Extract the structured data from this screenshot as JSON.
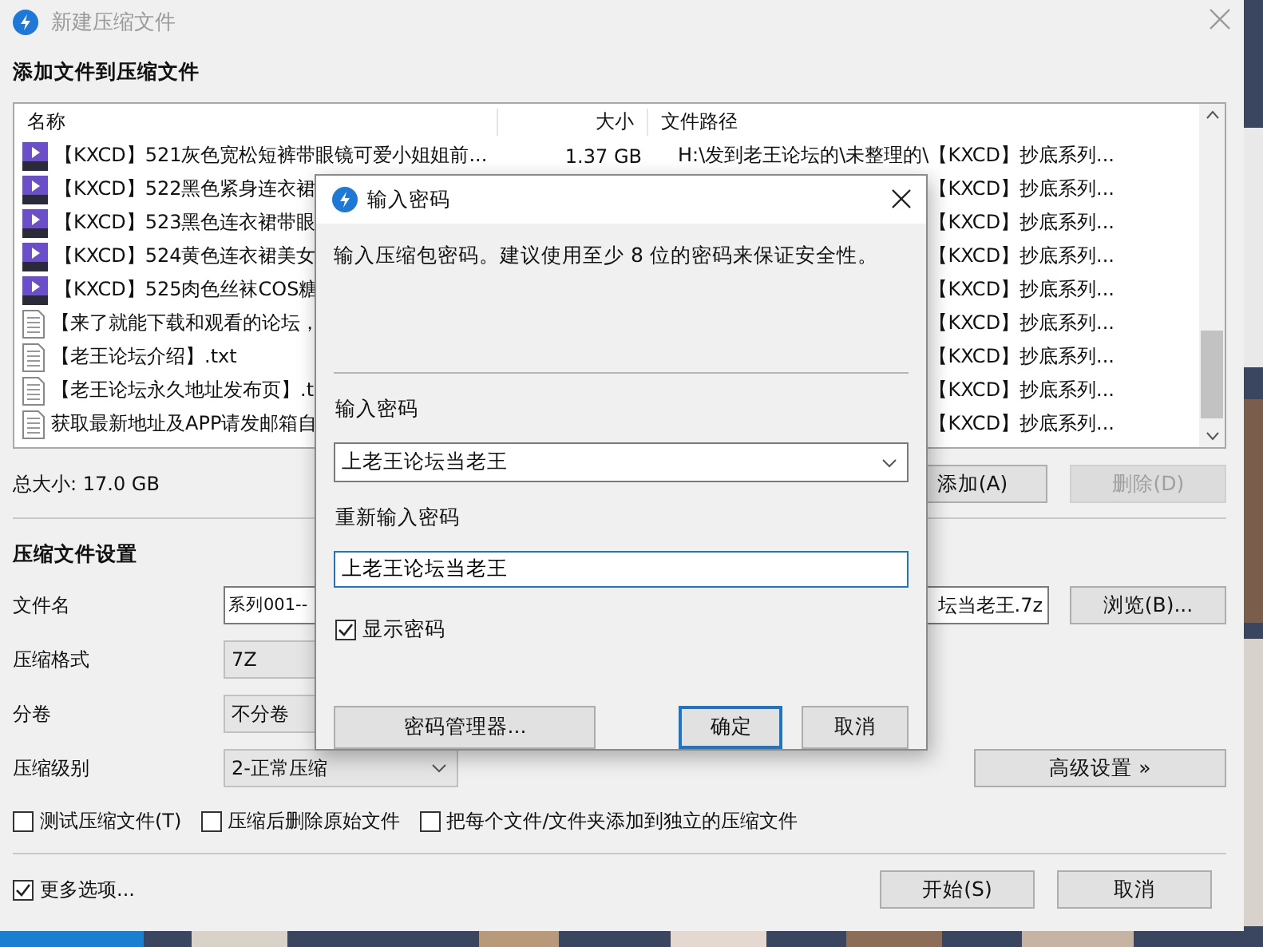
{
  "window": {
    "title": "新建压缩文件"
  },
  "add_section": {
    "heading": "添加文件到压缩文件"
  },
  "file_list": {
    "columns": [
      "名称",
      "大小",
      "文件路径"
    ],
    "rows": [
      {
        "kind": "video",
        "name": "【KXCD】521灰色宽松短裤带眼镜可爱小姐姐前...",
        "size": "1.37 GB",
        "path": "H:\\发到老王论坛的\\未整理的\\【KXCD】抄底系列..."
      },
      {
        "kind": "video",
        "name": "【KXCD】522黑色紧身连衣裙",
        "path": "【KXCD】抄底系列..."
      },
      {
        "kind": "video",
        "name": "【KXCD】523黑色连衣裙带眼",
        "path": "【KXCD】抄底系列..."
      },
      {
        "kind": "video",
        "name": "【KXCD】524黄色连衣裙美女",
        "path": "【KXCD】抄底系列..."
      },
      {
        "kind": "video",
        "name": "【KXCD】525肉色丝袜COS糖",
        "path": "【KXCD】抄底系列..."
      },
      {
        "kind": "text",
        "name": "【来了就能下载和观看的论坛，",
        "path": "【KXCD】抄底系列..."
      },
      {
        "kind": "text",
        "name": "【老王论坛介绍】.txt",
        "path": "【KXCD】抄底系列..."
      },
      {
        "kind": "text",
        "name": "【老王论坛永久地址发布页】.t",
        "path": "【KXCD】抄底系列..."
      },
      {
        "kind": "text",
        "name": "获取最新地址及APP请发邮箱自",
        "path": "【KXCD】抄底系列..."
      }
    ]
  },
  "total_size": "总大小: 17.0 GB",
  "list_buttons": [
    {
      "label": "添加(A)",
      "disabled": false
    },
    {
      "label": "删除(D)",
      "disabled": true
    }
  ],
  "settings": {
    "heading": "压缩文件设置",
    "filename": {
      "label": "文件名",
      "value_start": "系列001--",
      "value_end": "坛当老王.7z"
    },
    "browse_button": "浏览(B)...",
    "format": {
      "label": "压缩格式",
      "value": "7Z"
    },
    "volume": {
      "label": "分卷",
      "value": "不分卷"
    },
    "level": {
      "label": "压缩级别",
      "value": "2-正常压缩"
    },
    "advanced_button": "高级设置 »"
  },
  "options": [
    {
      "label": "测试压缩文件(T)",
      "checked": false
    },
    {
      "label": "压缩后删除原始文件",
      "checked": false
    },
    {
      "label": "把每个文件/文件夹添加到独立的压缩文件",
      "checked": false
    }
  ],
  "more_options": {
    "label": "更多选项...",
    "checked": true
  },
  "footer_buttons": [
    "开始(S)",
    "取消"
  ],
  "password_dialog": {
    "title": "输入密码",
    "message": "输入压缩包密码。建议使用至少 8 位的密码来保证安全性。",
    "password_label": "输入密码",
    "password": "上老王论坛当老王",
    "confirm_label": "重新输入密码",
    "confirm": "上老王论坛当老王",
    "show_password": {
      "label": "显示密码",
      "checked": true
    },
    "buttons": [
      {
        "label": "密码管理器...",
        "default": false
      },
      {
        "label": "确定",
        "default": true
      },
      {
        "label": "取消",
        "default": false
      }
    ]
  }
}
